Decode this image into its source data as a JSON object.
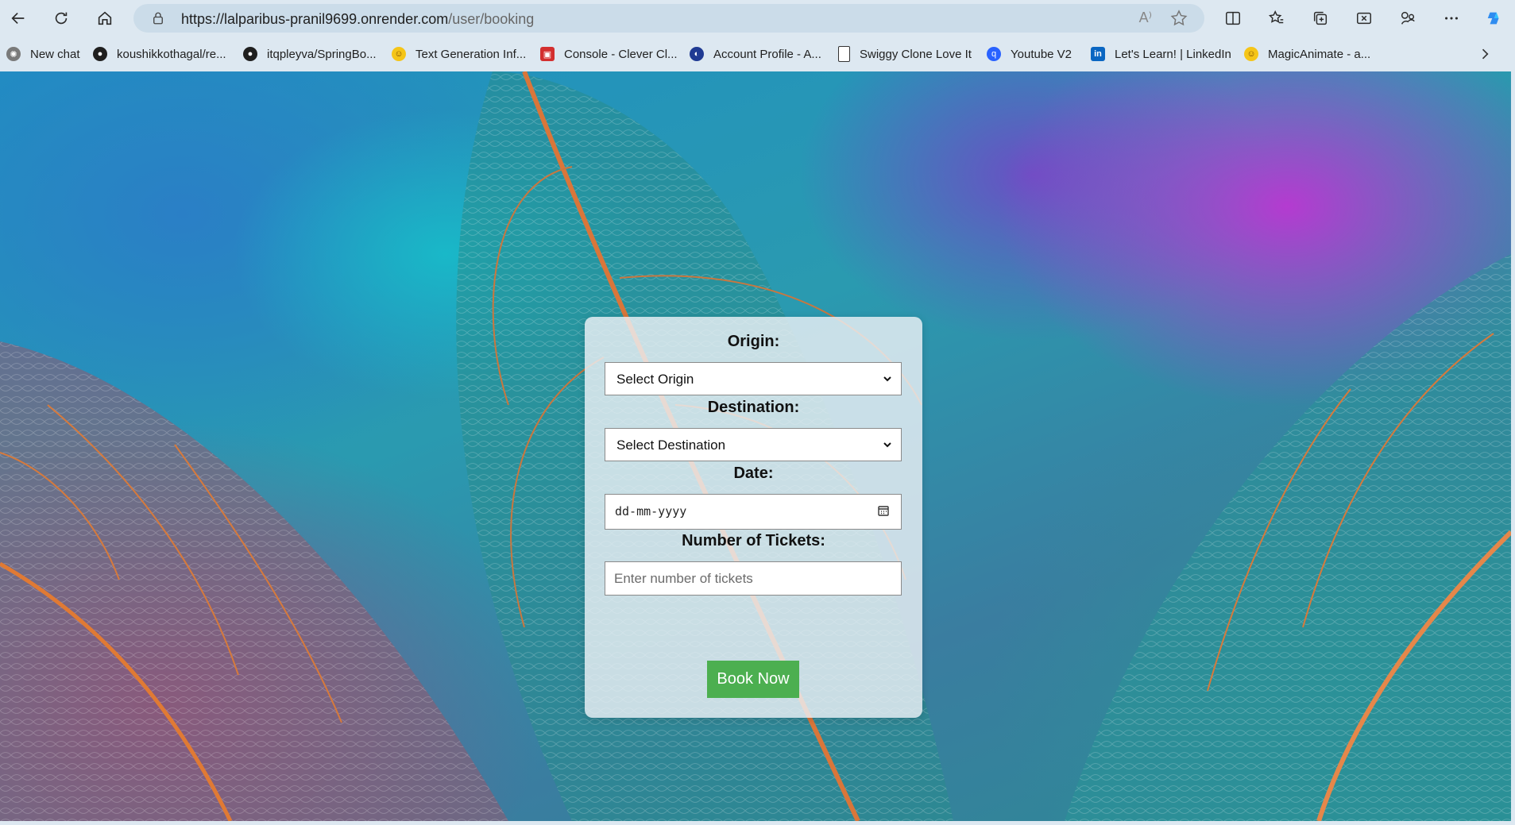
{
  "browser": {
    "url_host": "https://lalparibus-pranil9699.onrender.com",
    "url_path": "/user/booking",
    "read_aloud_label": "A⁾",
    "bookmarks": [
      {
        "label": "New chat",
        "icon": "openai-icon",
        "color": "#6b6b6b"
      },
      {
        "label": "koushikkothagal/re...",
        "icon": "github-icon",
        "color": "#1f1f1f"
      },
      {
        "label": "itqpleyva/SpringBo...",
        "icon": "github-icon",
        "color": "#1f1f1f"
      },
      {
        "label": "Text Generation Inf...",
        "icon": "hugging-face-icon",
        "color": "#f5c518"
      },
      {
        "label": "Console - Clever Cl...",
        "icon": "clever-cloud-icon",
        "color": "#d32f2f"
      },
      {
        "label": "Account Profile - A...",
        "icon": "profile-icon",
        "color": "#1f3a93"
      },
      {
        "label": "Swiggy Clone Love It",
        "icon": "page-icon",
        "color": "#ffffff"
      },
      {
        "label": "Youtube V2",
        "icon": "q-logo-icon",
        "color": "#2962ff"
      },
      {
        "label": "Let's Learn! | LinkedIn",
        "icon": "linkedin-icon",
        "color": "#0a66c2"
      },
      {
        "label": "MagicAnimate - a...",
        "icon": "hugging-face-icon",
        "color": "#f5c518"
      }
    ]
  },
  "form": {
    "origin_label": "Origin:",
    "origin_value": "Select Origin",
    "destination_label": "Destination:",
    "destination_value": "Select Destination",
    "date_label": "Date:",
    "date_placeholder": "dd-mm-yyyy",
    "tickets_label": "Number of Tickets:",
    "tickets_placeholder": "Enter number of tickets",
    "submit_label": "Book Now",
    "submit_color": "#4caf50"
  }
}
